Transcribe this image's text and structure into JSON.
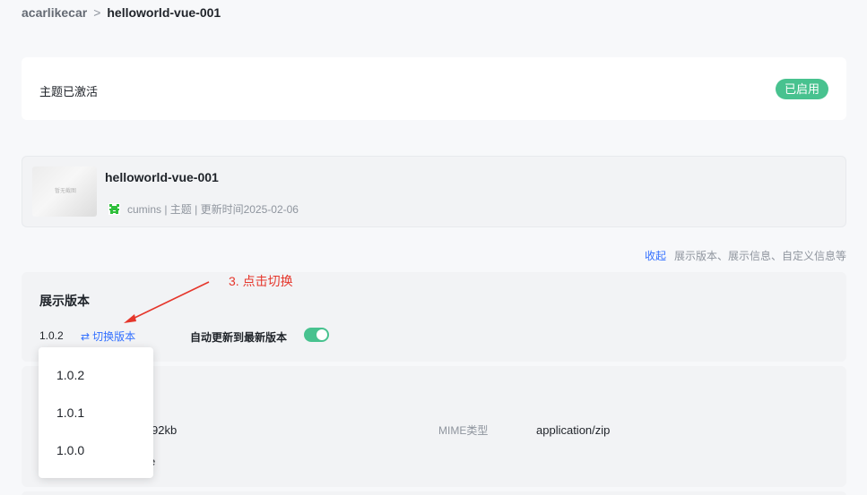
{
  "breadcrumb": {
    "parent": "acarlikecar",
    "separator": ">",
    "current": "helloworld-vue-001"
  },
  "status_card": {
    "label": "主题已激活",
    "badge": "已启用"
  },
  "theme_card": {
    "name": "helloworld-vue-001",
    "thumbnail_text": "暂无截图",
    "meta": "cumins | 主题 | 更新时间2025-02-06"
  },
  "collapse_row": {
    "link": "收起",
    "description": "展示版本、展示信息、自定义信息等"
  },
  "annotation": {
    "text": "3. 点击切换"
  },
  "version_card": {
    "title": "展示版本",
    "version": "1.0.2",
    "switch_label": "切换版本",
    "auto_update_label": "自动更新到最新版本",
    "auto_update_on": true
  },
  "info_card": {
    "size_partial": "92kb",
    "mime_label": "MIME类型",
    "mime_value": "application/zip",
    "partial_text": "e"
  },
  "dropdown": {
    "options": [
      "1.0.2",
      "1.0.1",
      "1.0.0"
    ]
  },
  "colors": {
    "accent_green": "#48c28f",
    "link_blue": "#3370ff",
    "annotation_red": "#e5362b"
  }
}
